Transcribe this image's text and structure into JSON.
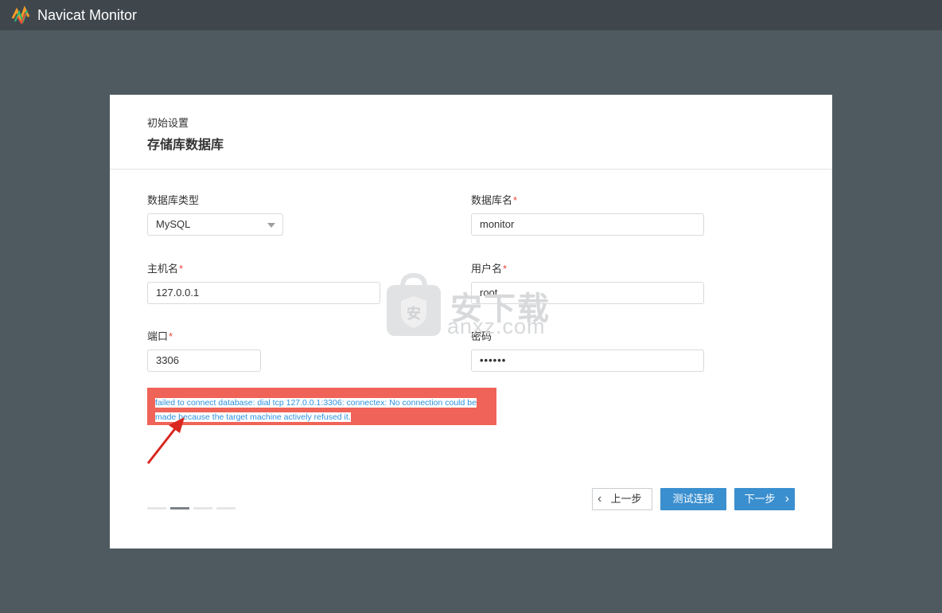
{
  "app": {
    "title": "Navicat Monitor"
  },
  "wizard": {
    "breadcrumb": "初始设置",
    "title": "存储库数据库",
    "fields": {
      "db_type": {
        "label": "数据库类型",
        "value": "MySQL"
      },
      "db_name": {
        "label": "数据库名",
        "required": "*",
        "value": "monitor"
      },
      "host": {
        "label": "主机名",
        "required": "*",
        "value": "127.0.0.1"
      },
      "user": {
        "label": "用户名",
        "required": "*",
        "value": "root"
      },
      "port": {
        "label": "端口",
        "required": "*",
        "value": "3306"
      },
      "password": {
        "label": "密码",
        "value": "••••••"
      }
    },
    "error": "failed to connect database: dial tcp 127.0.0.1:3306: connectex: No connection could be made because the target machine actively refused it.",
    "steps": {
      "total": 4,
      "current": 2
    },
    "buttons": {
      "prev": "上一步",
      "test": "测试连接",
      "next": "下一步"
    }
  },
  "watermark": {
    "text": "安下载",
    "sub": "anxz.com"
  },
  "colors": {
    "accent": "#3a8fcf",
    "error_bg": "#f06358",
    "required": "#e8463d",
    "topbar": "#3f474d",
    "background": "#4f5960"
  }
}
